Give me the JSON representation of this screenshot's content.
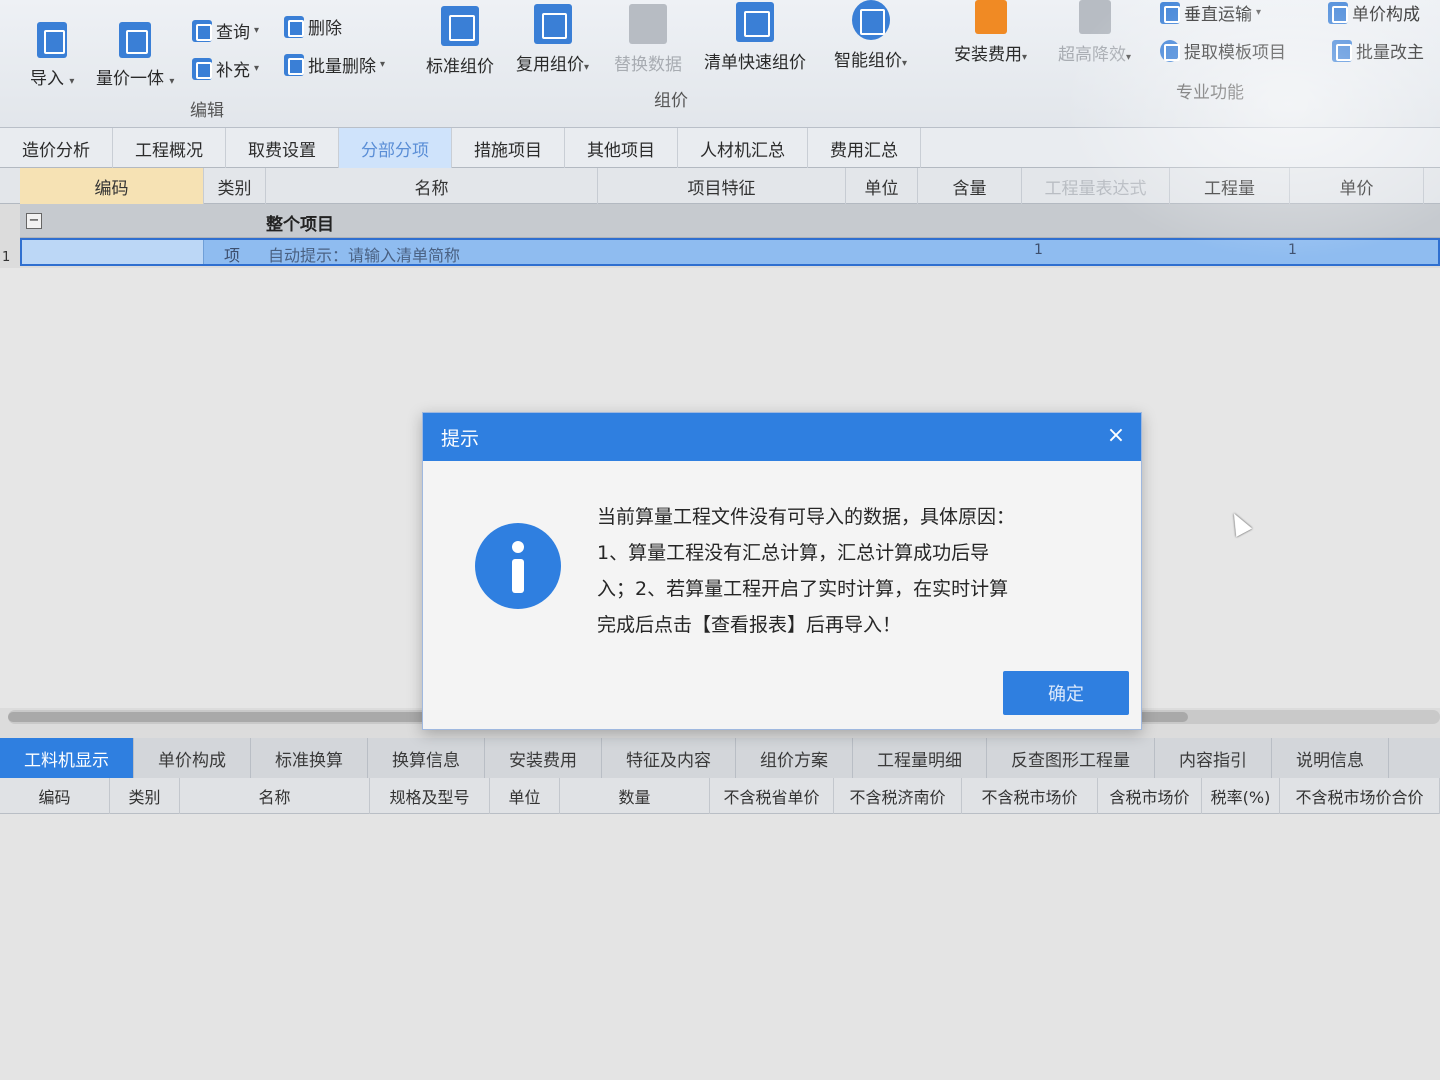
{
  "ribbon": {
    "import_label": "导入",
    "qty_price_label": "量价一体",
    "query_label": "查询",
    "delete_label": "删除",
    "supplement_label": "补充",
    "batch_delete_label": "批量删除",
    "edit_group_label": "编辑",
    "standard_pricing_label": "标准组价",
    "reuse_pricing_label": "复用组价",
    "replace_data_label": "替换数据",
    "quick_pricing_label": "清单快速组价",
    "smart_pricing_label": "智能组价",
    "pricing_group_label": "组价",
    "install_fee_label": "安装费用",
    "super_height_label": "超高降效",
    "vertical_transport_label": "垂直运输",
    "extract_template_label": "提取模板项目",
    "unit_price_comp_label": "单价构成",
    "batch_change_label": "批量改主",
    "pro_func_group_label": "专业功能"
  },
  "main_tabs": [
    {
      "label": "造价分析"
    },
    {
      "label": "工程概况"
    },
    {
      "label": "取费设置"
    },
    {
      "label": "分部分项"
    },
    {
      "label": "措施项目"
    },
    {
      "label": "其他项目"
    },
    {
      "label": "人材机汇总"
    },
    {
      "label": "费用汇总"
    }
  ],
  "grid": {
    "headers": {
      "code": "编码",
      "kind": "类别",
      "name": "名称",
      "feature": "项目特征",
      "unit": "单位",
      "content": "含量",
      "expr": "工程量表达式",
      "qty": "工程量",
      "price": "单价"
    },
    "group_row": "整个项目",
    "row_number": "1",
    "selected_row": {
      "kind": "项",
      "name": "自动提示：请输入清单简称",
      "content": "1",
      "qty": "1"
    }
  },
  "lower_tabs": [
    {
      "label": "工料机显示"
    },
    {
      "label": "单价构成"
    },
    {
      "label": "标准换算"
    },
    {
      "label": "换算信息"
    },
    {
      "label": "安装费用"
    },
    {
      "label": "特征及内容"
    },
    {
      "label": "组价方案"
    },
    {
      "label": "工程量明细"
    },
    {
      "label": "反查图形工程量"
    },
    {
      "label": "内容指引"
    },
    {
      "label": "说明信息"
    }
  ],
  "lower_headers": {
    "code": "编码",
    "kind": "类别",
    "name": "名称",
    "spec": "规格及型号",
    "unit": "单位",
    "qty": "数量",
    "no_tax_prov": "不含税省单价",
    "no_tax_jinan": "不含税济南价",
    "no_tax_market": "不含税市场价",
    "tax_market": "含税市场价",
    "tax_rate": "税率(%)",
    "no_tax_market_total": "不含税市场价合价"
  },
  "dialog": {
    "title": "提示",
    "close": "×",
    "line1": "当前算量工程文件没有可导入的数据，具体原因：",
    "line2": "1、算量工程没有汇总计算，汇总计算成功后导",
    "line3": "入；2、若算量工程开启了实时计算，在实时计算",
    "line4": "完成后点击【查看报表】后再导入！",
    "ok_label": "确定"
  },
  "colors": {
    "accent": "#2f7fe0",
    "selected_row": "#8fbcf0",
    "code_header": "#f6e2b4"
  }
}
